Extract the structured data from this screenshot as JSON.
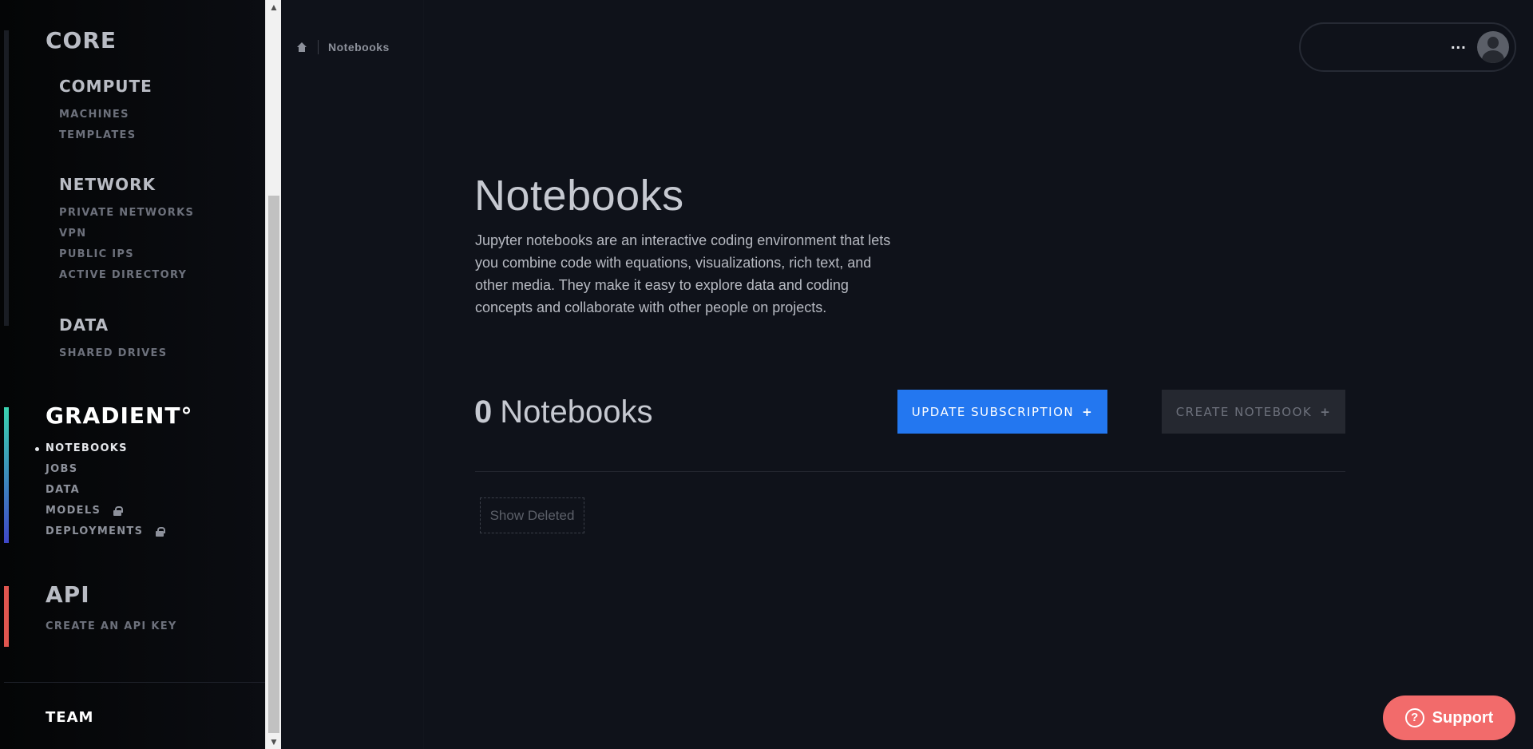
{
  "sidebar": {
    "core": {
      "title": "CORE",
      "compute": {
        "title": "COMPUTE",
        "items": [
          "MACHINES",
          "TEMPLATES"
        ]
      },
      "network": {
        "title": "NETWORK",
        "items": [
          "PRIVATE NETWORKS",
          "VPN",
          "PUBLIC IPS",
          "ACTIVE DIRECTORY"
        ]
      },
      "data": {
        "title": "DATA",
        "items": [
          "SHARED DRIVES"
        ]
      }
    },
    "gradient": {
      "title": "GRADIENT°",
      "items": [
        {
          "label": "NOTEBOOKS",
          "active": true,
          "locked": false
        },
        {
          "label": "JOBS",
          "active": false,
          "locked": false
        },
        {
          "label": "DATA",
          "active": false,
          "locked": false
        },
        {
          "label": "MODELS",
          "active": false,
          "locked": true
        },
        {
          "label": "DEPLOYMENTS",
          "active": false,
          "locked": true
        }
      ]
    },
    "api": {
      "title": "API",
      "items": [
        "CREATE AN API KEY"
      ]
    },
    "team": {
      "title": "TEAM"
    },
    "accent_colors": {
      "core": "#1a1d24",
      "gradient_top": "#3ad3b0",
      "gradient_bottom": "#3f47c8",
      "api": "#e0564f"
    }
  },
  "breadcrumb": {
    "current": "Notebooks"
  },
  "user_menu": {
    "dots": "..."
  },
  "main": {
    "title": "Notebooks",
    "description": "Jupyter notebooks are an interactive coding environment that lets you combine code with equations, visualizations, rich text, and other media. They make it easy to explore data and coding concepts and collaborate with other people on projects.",
    "count": "0",
    "count_label": "Notebooks",
    "update_button": "UPDATE SUBSCRIPTION",
    "create_button": "CREATE NOTEBOOK",
    "show_deleted": "Show Deleted"
  },
  "support": {
    "label": "Support"
  },
  "colors": {
    "primary": "#2377f0",
    "support": "#f26b6b",
    "background": "#0f121a"
  }
}
